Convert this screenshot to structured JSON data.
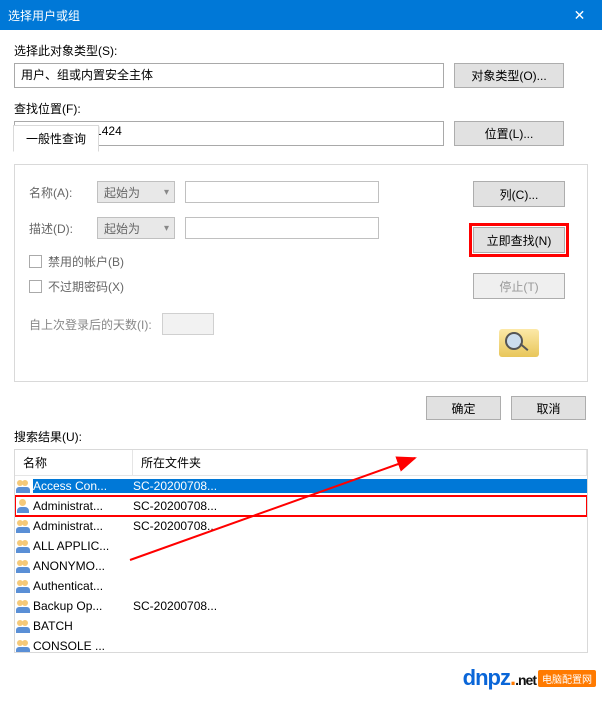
{
  "titlebar": {
    "title": "选择用户或组",
    "close": "✕"
  },
  "object_type": {
    "label": "选择此对象类型(S):",
    "value": "用户、组或内置安全主体",
    "button": "对象类型(O)..."
  },
  "location": {
    "label": "查找位置(F):",
    "value": "SC-202007081424",
    "button": "位置(L)..."
  },
  "tab": {
    "label": "一般性查询"
  },
  "query": {
    "name_label": "名称(A):",
    "name_combo": "起始为",
    "desc_label": "描述(D):",
    "desc_combo": "起始为",
    "chk_disabled": "禁用的帐户(B)",
    "chk_noexpire": "不过期密码(X)",
    "days_label": "自上次登录后的天数(I):"
  },
  "buttons": {
    "columns": "列(C)...",
    "find_now": "立即查找(N)",
    "stop": "停止(T)",
    "ok": "确定",
    "cancel": "取消"
  },
  "results": {
    "label": "搜索结果(U):",
    "col_name": "名称",
    "col_folder": "所在文件夹",
    "rows": [
      {
        "type": "group",
        "name": "Access Con...",
        "folder": "SC-20200708...",
        "selected": true
      },
      {
        "type": "user",
        "name": "Administrat...",
        "folder": "SC-20200708...",
        "boxed": true
      },
      {
        "type": "group",
        "name": "Administrat...",
        "folder": "SC-20200708..."
      },
      {
        "type": "group",
        "name": "ALL APPLIC...",
        "folder": ""
      },
      {
        "type": "group",
        "name": "ANONYMO...",
        "folder": ""
      },
      {
        "type": "group",
        "name": "Authenticat...",
        "folder": ""
      },
      {
        "type": "group",
        "name": "Backup Op...",
        "folder": "SC-20200708..."
      },
      {
        "type": "group",
        "name": "BATCH",
        "folder": ""
      },
      {
        "type": "group",
        "name": "CONSOLE ...",
        "folder": ""
      }
    ]
  },
  "watermark": {
    "badge": "电脑配置网",
    "brand": "dnpz",
    "suffix": ".net"
  }
}
